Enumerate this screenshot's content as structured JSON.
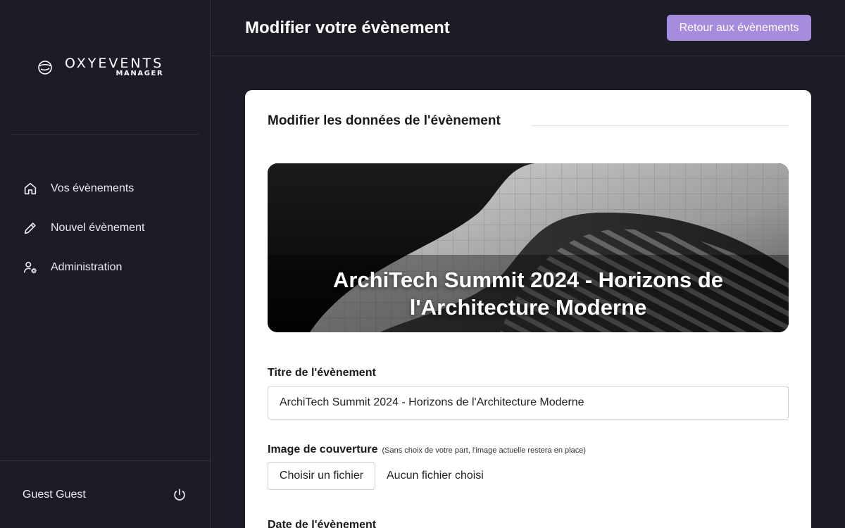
{
  "brand": {
    "name": "OXYEVENTS",
    "sub": "MANAGER"
  },
  "sidebar": {
    "items": [
      {
        "label": "Vos évènements",
        "icon": "home-icon"
      },
      {
        "label": "Nouvel évènement",
        "icon": "pencil-icon"
      },
      {
        "label": "Administration",
        "icon": "user-settings-icon"
      }
    ],
    "user": "Guest Guest"
  },
  "header": {
    "title": "Modifier votre évènement",
    "back_label": "Retour aux évènements"
  },
  "form": {
    "section_title": "Modifier les données de l'évènement",
    "cover_title": "ArchiTech Summit 2024 - Horizons de l'Architecture Moderne",
    "title_label": "Titre de l'évènement",
    "title_value": "ArchiTech Summit 2024 - Horizons de l'Architecture Moderne",
    "image_label": "Image de couverture",
    "image_hint": "(Sans choix de votre part, l'image actuelle restera en place)",
    "file_button": "Choisir un fichier",
    "file_status": "Aucun fichier choisi",
    "date_label": "Date de l'évènement"
  },
  "colors": {
    "background": "#1b1c26",
    "accent": "#a78bdd",
    "card": "#ffffff"
  }
}
